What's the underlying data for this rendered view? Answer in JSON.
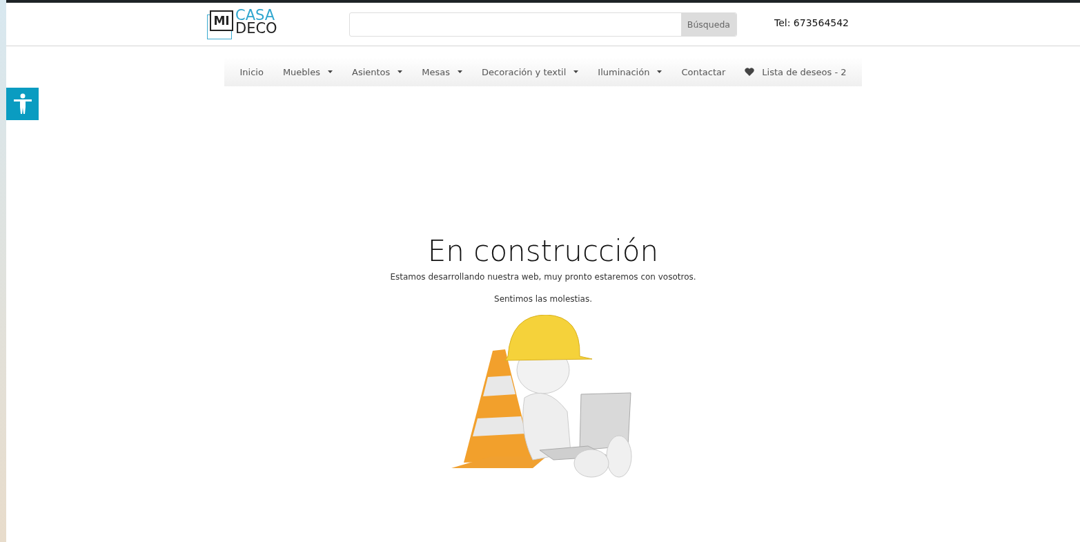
{
  "logo": {
    "boxed": "MI",
    "top": "CASA",
    "bottom": "DECO"
  },
  "search": {
    "button": "Búsqueda"
  },
  "phone": "Tel: 673564542",
  "nav": [
    {
      "label": "Inicio",
      "kind": "link",
      "dropdown": false
    },
    {
      "label": "Muebles",
      "kind": "link",
      "dropdown": true
    },
    {
      "label": "Asientos",
      "kind": "link",
      "dropdown": true
    },
    {
      "label": "Mesas",
      "kind": "link",
      "dropdown": true
    },
    {
      "label": "Decoración y textil",
      "kind": "link",
      "dropdown": true
    },
    {
      "label": "Iluminación",
      "kind": "link",
      "dropdown": true
    },
    {
      "label": "Contactar",
      "kind": "link",
      "dropdown": false
    },
    {
      "label": "Lista de deseos - 2",
      "kind": "wishlist",
      "dropdown": false
    }
  ],
  "main": {
    "heading": "En construcción",
    "paragraphs": [
      "Estamos desarrollando nuestra web, muy pronto estaremos con vosotros.",
      "Sentimos las molestias."
    ]
  }
}
